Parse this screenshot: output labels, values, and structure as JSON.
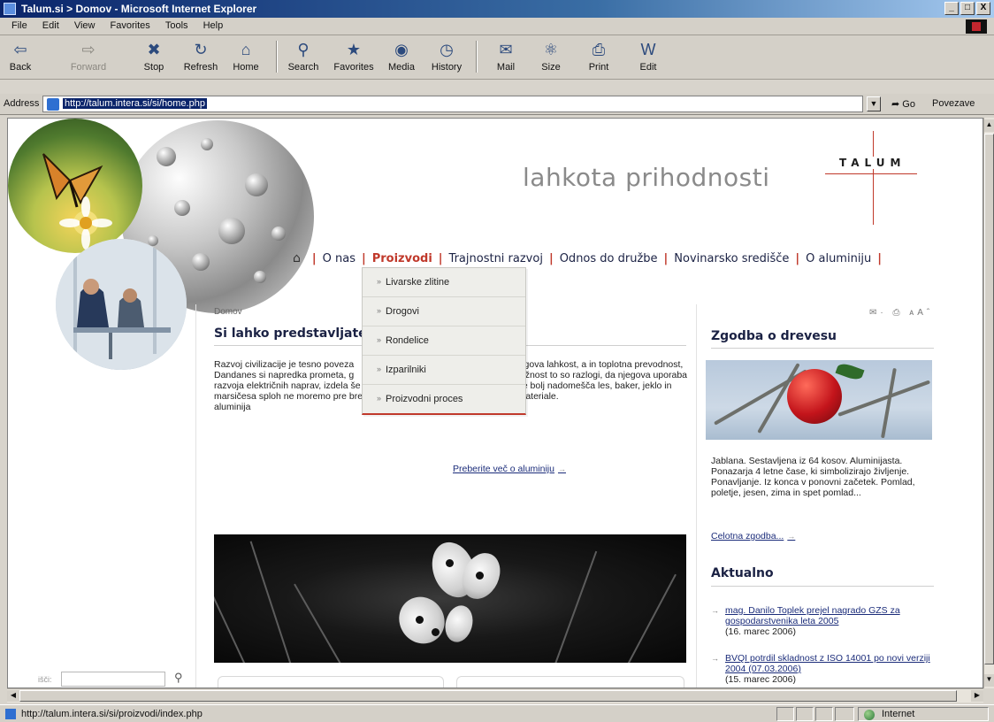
{
  "window": {
    "title": "Talum.si > Domov - Microsoft Internet Explorer",
    "buttons": [
      "_",
      "□",
      "X"
    ]
  },
  "menu": [
    "File",
    "Edit",
    "View",
    "Favorites",
    "Tools",
    "Help"
  ],
  "toolbar": {
    "back": "Back",
    "forward": "Forward",
    "stop": "Stop",
    "refresh": "Refresh",
    "home": "Home",
    "search": "Search",
    "favorites": "Favorites",
    "media": "Media",
    "history": "History",
    "mail": "Mail",
    "size": "Size",
    "print": "Print",
    "edit": "Edit"
  },
  "address": {
    "label": "Address",
    "url": "http://talum.intera.si/si/home.php",
    "go": "Go",
    "links": "Povezave"
  },
  "site": {
    "slogan": "lahkota prihodnosti",
    "logo": "TALUM",
    "nav": {
      "home_icon": "⌂",
      "items": [
        "O nas",
        "Proizvodi",
        "Trajnostni razvoj",
        "Odnos do družbe",
        "Novinarsko središče",
        "O aluminiju"
      ]
    },
    "dropdown": [
      "Livarske zlitine",
      "Drogovi",
      "Rondelice",
      "Izparilniki",
      "Proizvodni proces"
    ],
    "breadcrumb": "Domov",
    "tools": "✉· ⎙ ᴬᴬˆ",
    "main": {
      "title": "Si lahko predstavljate s",
      "para1": "Razvoj civilizacije je tesno poveza Dandanes si napredka prometa, g razvoja električnih naprav, izdela še marsičesa sploh ne moremo pre brez aluminija",
      "para2": "osti aluminija, njegova lahkost, a in toplotna prevodnost, unanje vplive, možnost to so razlogi, da njegova uporaba narašča in čedalje bolj nadomešča les, baker, jeklo in druge podobne materiale.",
      "readmore": "Preberite več o aluminiju"
    },
    "search_label": "išči:",
    "search_icon": "⚲",
    "side": {
      "story_title": "Zgodba o drevesu",
      "story_text": "Jablana. Sestavljena iz 64 kosov. Aluminijasta. Ponazarja 4 letne čase, ki simbolizirajo življenje. Ponavljanje. Iz konca v ponovni začetek. Pomlad, poletje, jesen, zima in spet pomlad...",
      "story_link": "Celotna zgodba...",
      "news_title": "Aktualno",
      "news": [
        {
          "link": "mag. Danilo Toplek prejel nagrado GZS za gospodarstvenika leta 2005",
          "date": "(16. marec 2006)"
        },
        {
          "link": "BVQI potrdil skladnost z ISO 14001 po novi verziji 2004 (07.03.2006)",
          "date": "(15. marec 2006)"
        }
      ]
    }
  },
  "status": {
    "text": "http://talum.intera.si/si/proizvodi/index.php",
    "zone": "Internet"
  }
}
